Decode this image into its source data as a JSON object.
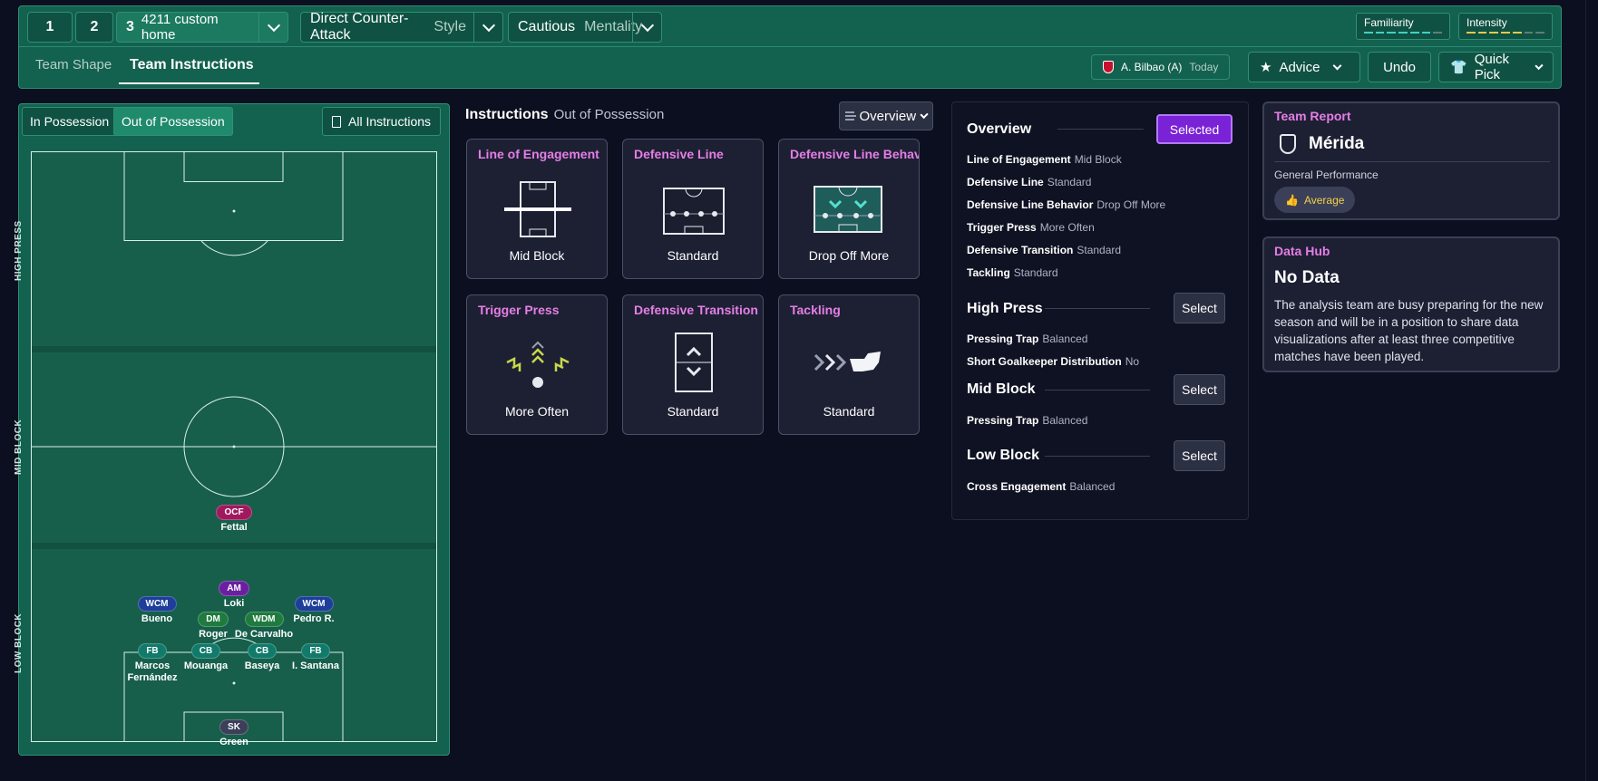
{
  "topbar": {
    "tactic_slots": [
      "1",
      "2",
      "3"
    ],
    "tactic_name": "4211 custom home",
    "style_value": "Direct Counter-Attack",
    "style_label": "Style",
    "mentality_value": "Cautious",
    "mentality_label": "Mentality",
    "familiarity_label": "Familiarity",
    "intensity_label": "Intensity",
    "tabs": [
      "Team Shape",
      "Team Instructions"
    ],
    "next_match": "A. Bilbao (A)",
    "next_match_when": "Today",
    "advice_label": "Advice",
    "undo_label": "Undo",
    "quick_pick_label": "Quick Pick",
    "colors": {
      "bar": "#13614f",
      "familiarity": "#3fd1c2",
      "intensity": "#e3c94a"
    }
  },
  "pitch_panel": {
    "in_possession": "In Possession",
    "out_of_possession": "Out of Possession",
    "all_instructions": "All Instructions",
    "zones": [
      "HIGH PRESS",
      "MID BLOCK",
      "LOW BLOCK"
    ],
    "players": [
      {
        "pos": "OCF",
        "name": "Fettal",
        "color": "#a0195e"
      },
      {
        "pos": "AM",
        "name": "Loki",
        "color": "#6a1fa0"
      },
      {
        "pos": "WCM",
        "name": "Bueno",
        "color": "#1d3f9a"
      },
      {
        "pos": "WCM",
        "name": "Pedro R.",
        "color": "#1d3f9a"
      },
      {
        "pos": "DM",
        "name": "Roger",
        "color": "#1f7a3e"
      },
      {
        "pos": "WDM",
        "name": "De Carvalho",
        "color": "#1f7a3e"
      },
      {
        "pos": "FB",
        "name": "Marcos Fernández",
        "color": "#117a6b"
      },
      {
        "pos": "CB",
        "name": "Mouanga",
        "color": "#117a6b"
      },
      {
        "pos": "CB",
        "name": "Baseya",
        "color": "#117a6b"
      },
      {
        "pos": "FB",
        "name": "I. Santana",
        "color": "#117a6b"
      },
      {
        "pos": "SK",
        "name": "Green",
        "color": "#3b3f58"
      }
    ]
  },
  "instructions": {
    "title": "Instructions",
    "subtitle": "Out of Possession",
    "view_label": "Overview",
    "cards": [
      {
        "title": "Line of Engagement",
        "value": "Mid Block"
      },
      {
        "title": "Defensive Line",
        "value": "Standard"
      },
      {
        "title": "Defensive Line Behavio",
        "value": "Drop Off More"
      },
      {
        "title": "Trigger Press",
        "value": "More Often"
      },
      {
        "title": "Defensive Transition",
        "value": "Standard"
      },
      {
        "title": "Tackling",
        "value": "Standard"
      }
    ]
  },
  "overview": {
    "title": "Overview",
    "selected_label": "Selected",
    "rows": [
      {
        "k": "Line of Engagement",
        "v": "Mid Block"
      },
      {
        "k": "Defensive Line",
        "v": "Standard"
      },
      {
        "k": "Defensive Line Behavior",
        "v": "Drop Off More"
      },
      {
        "k": "Trigger Press",
        "v": "More Often"
      },
      {
        "k": "Defensive Transition",
        "v": "Standard"
      },
      {
        "k": "Tackling",
        "v": "Standard"
      }
    ],
    "high_press": {
      "title": "High Press",
      "button": "Select",
      "rows": [
        {
          "k": "Pressing Trap",
          "v": "Balanced"
        },
        {
          "k": "Short Goalkeeper Distribution",
          "v": "No"
        }
      ]
    },
    "mid_block": {
      "title": "Mid Block",
      "button": "Select",
      "rows": [
        {
          "k": "Pressing Trap",
          "v": "Balanced"
        }
      ]
    },
    "low_block": {
      "title": "Low Block",
      "button": "Select",
      "rows": [
        {
          "k": "Cross Engagement",
          "v": "Balanced"
        }
      ]
    }
  },
  "team_report": {
    "title": "Team Report",
    "team": "Mérida",
    "perf_label": "General Performance",
    "perf_value": "Average"
  },
  "data_hub": {
    "title": "Data Hub",
    "heading": "No Data",
    "text": "The analysis team are busy preparing for the new season and will be in a position to share data visualizations after at least three competitive matches have been played."
  }
}
